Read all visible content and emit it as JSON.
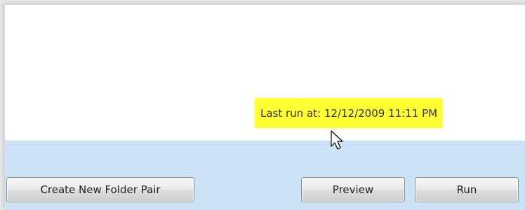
{
  "status": {
    "last_run_text": "Last run at: 12/12/2009 11:11 PM"
  },
  "footer": {
    "create_label": "Create New Folder Pair",
    "preview_label": "Preview",
    "run_label": "Run"
  },
  "colors": {
    "highlight": "#ffff33",
    "footer_bg": "#cce2f6"
  },
  "icons": {
    "cursor": "mouse-pointer-icon"
  }
}
